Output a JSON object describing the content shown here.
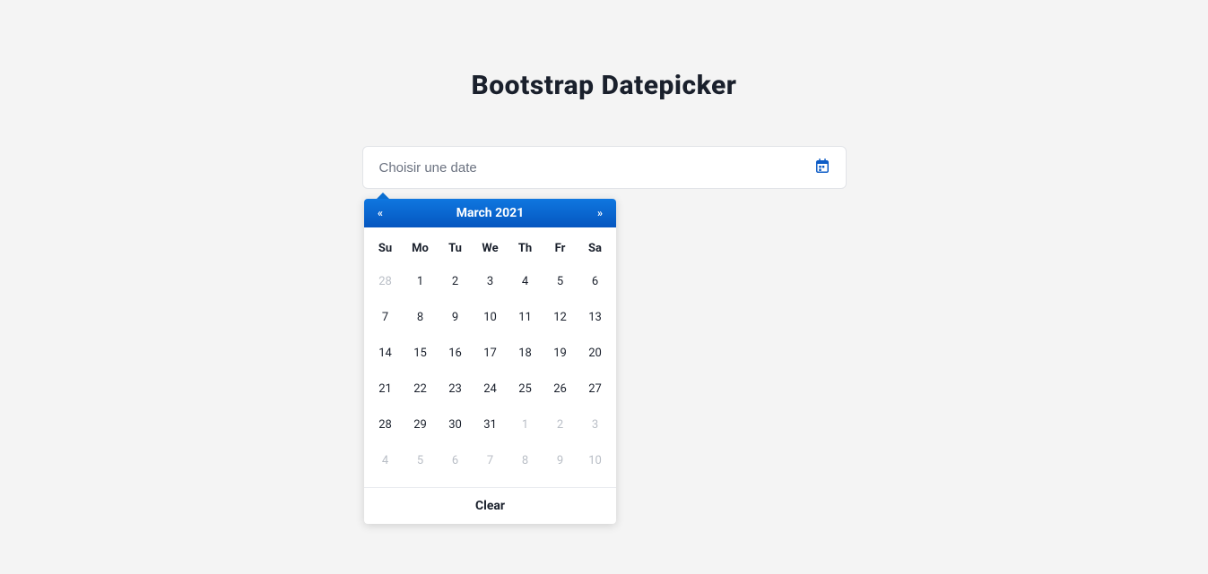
{
  "title": "Bootstrap Datepicker",
  "input": {
    "placeholder": "Choisir une date",
    "value": ""
  },
  "picker": {
    "prev": "«",
    "next": "»",
    "month_label": "March 2021",
    "dow": [
      "Su",
      "Mo",
      "Tu",
      "We",
      "Th",
      "Fr",
      "Sa"
    ],
    "weeks": [
      [
        {
          "d": "28",
          "other": true
        },
        {
          "d": "1"
        },
        {
          "d": "2"
        },
        {
          "d": "3"
        },
        {
          "d": "4"
        },
        {
          "d": "5"
        },
        {
          "d": "6"
        }
      ],
      [
        {
          "d": "7"
        },
        {
          "d": "8"
        },
        {
          "d": "9"
        },
        {
          "d": "10"
        },
        {
          "d": "11"
        },
        {
          "d": "12"
        },
        {
          "d": "13"
        }
      ],
      [
        {
          "d": "14"
        },
        {
          "d": "15"
        },
        {
          "d": "16"
        },
        {
          "d": "17"
        },
        {
          "d": "18"
        },
        {
          "d": "19"
        },
        {
          "d": "20"
        }
      ],
      [
        {
          "d": "21"
        },
        {
          "d": "22"
        },
        {
          "d": "23"
        },
        {
          "d": "24"
        },
        {
          "d": "25"
        },
        {
          "d": "26"
        },
        {
          "d": "27"
        }
      ],
      [
        {
          "d": "28"
        },
        {
          "d": "29"
        },
        {
          "d": "30"
        },
        {
          "d": "31"
        },
        {
          "d": "1",
          "other": true
        },
        {
          "d": "2",
          "other": true
        },
        {
          "d": "3",
          "other": true
        }
      ],
      [
        {
          "d": "4",
          "other": true
        },
        {
          "d": "5",
          "other": true
        },
        {
          "d": "6",
          "other": true
        },
        {
          "d": "7",
          "other": true
        },
        {
          "d": "8",
          "other": true
        },
        {
          "d": "9",
          "other": true
        },
        {
          "d": "10",
          "other": true
        }
      ]
    ],
    "clear": "Clear"
  }
}
